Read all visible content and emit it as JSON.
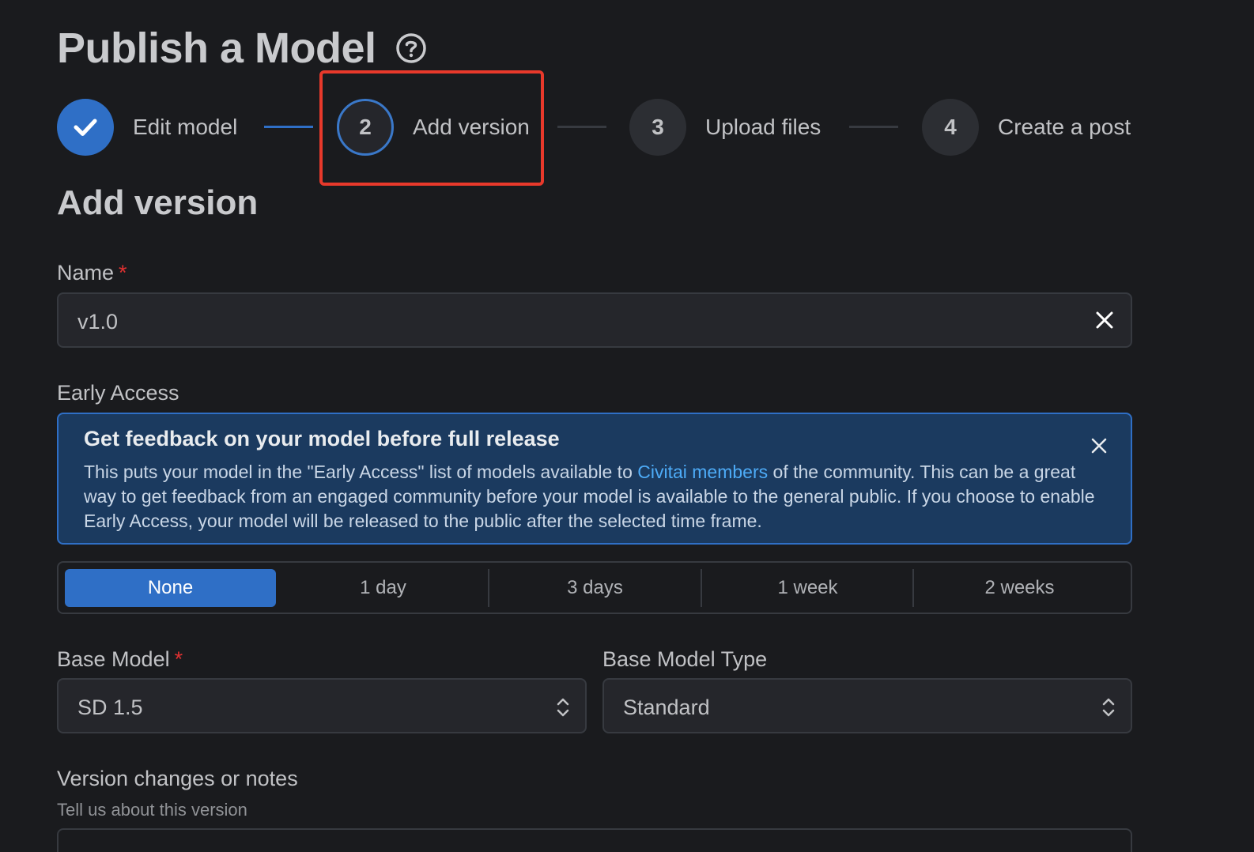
{
  "page": {
    "title": "Publish a Model"
  },
  "stepper": {
    "steps": [
      {
        "number": "",
        "label": "Edit model",
        "state": "completed"
      },
      {
        "number": "2",
        "label": "Add version",
        "state": "active"
      },
      {
        "number": "3",
        "label": "Upload files",
        "state": "pending"
      },
      {
        "number": "4",
        "label": "Create a post",
        "state": "pending"
      }
    ]
  },
  "section": {
    "title": "Add version"
  },
  "name_field": {
    "label": "Name",
    "required_mark": "*",
    "value": "v1.0"
  },
  "early_access": {
    "label": "Early Access",
    "alert_title": "Get feedback on your model before full release",
    "alert_text_before_link": "This puts your model in the \"Early Access\" list of models available to ",
    "alert_link": "Civitai members",
    "alert_text_after_link": " of the community. This can be a great way to get feedback from an engaged community before your model is available to the general public. If you choose to enable Early Access, your model will be released to the public after the selected time frame.",
    "options": [
      "None",
      "1 day",
      "3 days",
      "1 week",
      "2 weeks"
    ],
    "selected": "None"
  },
  "base_model": {
    "label": "Base Model",
    "required_mark": "*",
    "value": "SD 1.5"
  },
  "base_model_type": {
    "label": "Base Model Type",
    "value": "Standard"
  },
  "notes": {
    "label": "Version changes or notes",
    "description": "Tell us about this version"
  },
  "colors": {
    "accent": "#2f6fc6",
    "highlight": "#e8392b",
    "required": "#e03131",
    "link": "#4dabf7",
    "alert_bg": "#1b3a5f"
  },
  "icons": {
    "help": "question-circle-icon",
    "completed_step": "check-icon",
    "clear": "close-icon",
    "select": "chevron-up-down-icon"
  }
}
